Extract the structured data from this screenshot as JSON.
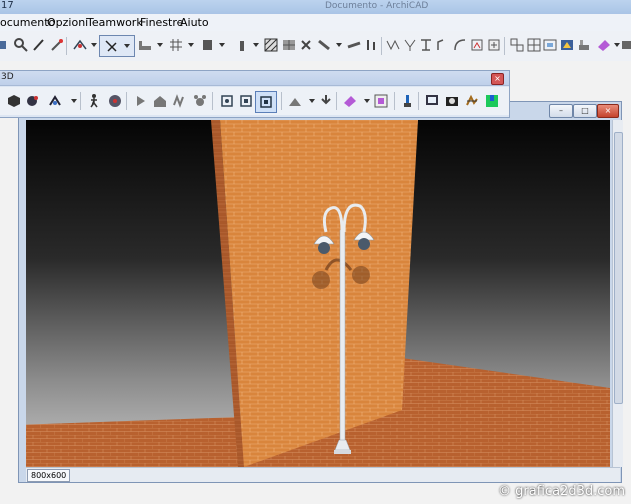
{
  "app": {
    "title_fragment": "17",
    "doc_title": "Documento - ArchiCAD"
  },
  "menu": {
    "items": [
      "ocumento",
      "Opzioni",
      "Teamwork",
      "Finestre",
      "Aiuto"
    ]
  },
  "palette": {
    "title_fragment": "3D",
    "close_glyph": "×"
  },
  "window3d": {
    "controls": {
      "minimize": "–",
      "maximize": "□",
      "close": "×"
    },
    "status_size": "800x600"
  },
  "scene": {
    "background_top": "#050505",
    "background_bottom": "#c8c8c8",
    "brick_color": "#d9853c",
    "floor_color": "#b85a2c",
    "lamp_color": "#e8ecf0"
  },
  "watermark": "© grafica2d3d.com",
  "icons": {
    "toolbar": [
      "magnify-icon",
      "pencil-icon",
      "wand-icon",
      "trace-icon",
      "select-arrow-icon",
      "wall-icon",
      "grid-snap-icon",
      "column-icon",
      "object-icon",
      "hatch-icon",
      "beam-icon",
      "slab-icon",
      "roof-icon",
      "dimension-icon",
      "level-icon",
      "label-icon",
      "arc-icon",
      "shape-icon",
      "image-icon",
      "group-icon",
      "ungroup-icon",
      "layout-icon",
      "render-icon",
      "publish-icon"
    ],
    "palette": [
      "cube-icon",
      "orbit-icon",
      "navigate-icon",
      "walk-icon",
      "camera-icon",
      "zoom-icon",
      "house-icon",
      "sun-icon",
      "fly-icon",
      "section-icon",
      "view-a-icon",
      "view-b-icon",
      "active-view-icon",
      "fit-icon",
      "light-icon",
      "material-icon",
      "monitor-icon",
      "photo-icon",
      "render-icon",
      "green-map-icon"
    ]
  }
}
